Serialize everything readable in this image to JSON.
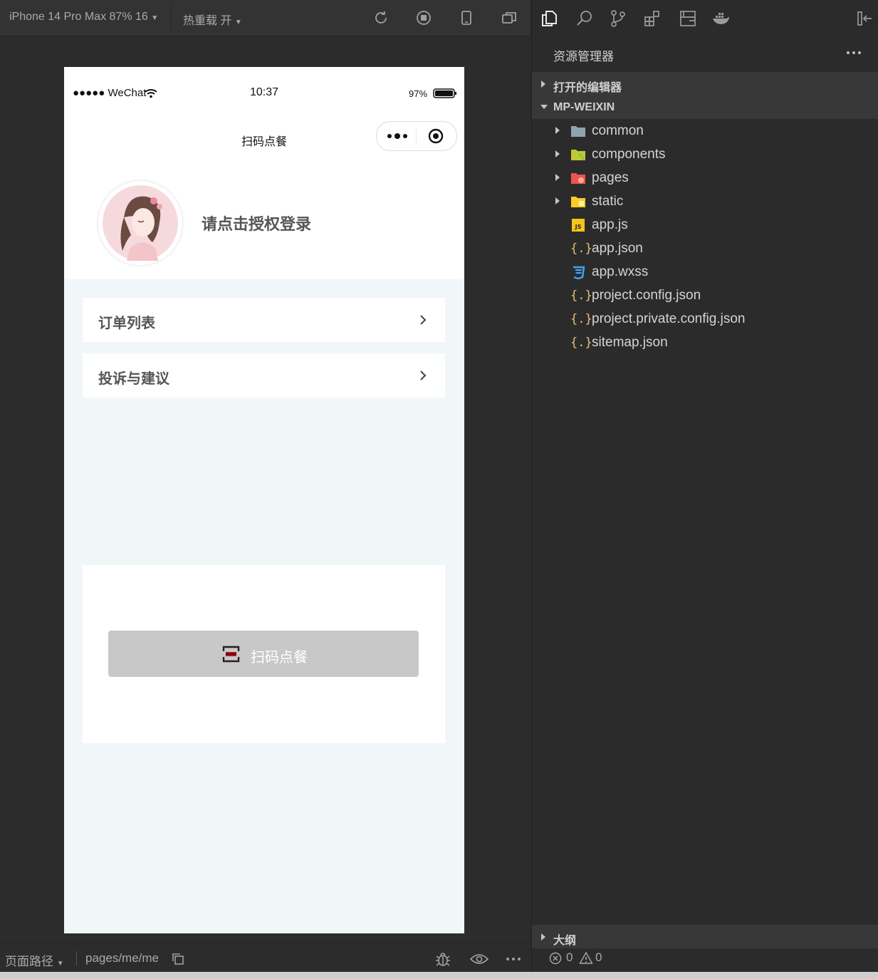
{
  "simulator": {
    "toolbar": {
      "device_label": "iPhone 14 Pro Max 87% 16",
      "hot_reload_label": "热重载 开"
    },
    "phone": {
      "status_bar": {
        "carrier": "●●●●● WeChat",
        "time": "10:37",
        "battery": "97%"
      },
      "nav_title": "扫码点餐",
      "login_text": "请点击授权登录",
      "menu": [
        {
          "label": "订单列表"
        },
        {
          "label": "投诉与建议"
        }
      ],
      "scan_button_label": "扫码点餐"
    },
    "bottom_bar": {
      "path_label": "页面路径",
      "path_value": "pages/me/me"
    }
  },
  "explorer": {
    "title": "资源管理器",
    "sections": {
      "open_editors": "打开的编辑器",
      "project": "MP-WEIXIN",
      "outline": "大纲"
    },
    "files": [
      {
        "name": "common",
        "type": "folder",
        "icon": "folder-icon"
      },
      {
        "name": "components",
        "type": "folder",
        "icon": "components-folder-icon"
      },
      {
        "name": "pages",
        "type": "folder",
        "icon": "pages-folder-icon"
      },
      {
        "name": "static",
        "type": "folder",
        "icon": "static-folder-icon"
      },
      {
        "name": "app.js",
        "type": "file",
        "icon": "js-file-icon"
      },
      {
        "name": "app.json",
        "type": "file",
        "icon": "json-file-icon"
      },
      {
        "name": "app.wxss",
        "type": "file",
        "icon": "css-file-icon"
      },
      {
        "name": "project.config.json",
        "type": "file",
        "icon": "json-file-icon"
      },
      {
        "name": "project.private.config.json",
        "type": "file",
        "icon": "json-file-icon"
      },
      {
        "name": "sitemap.json",
        "type": "file",
        "icon": "json-file-icon"
      }
    ],
    "status": {
      "errors": "0",
      "warnings": "0"
    }
  },
  "colors": {
    "ide_background": "#2b2b2b",
    "phone_page_background": "#f1f7f9",
    "scan_button": "#c8c8c8",
    "json_icon": "#e5c07b",
    "js_icon": "#f5c518",
    "css_icon": "#42a5f5"
  }
}
